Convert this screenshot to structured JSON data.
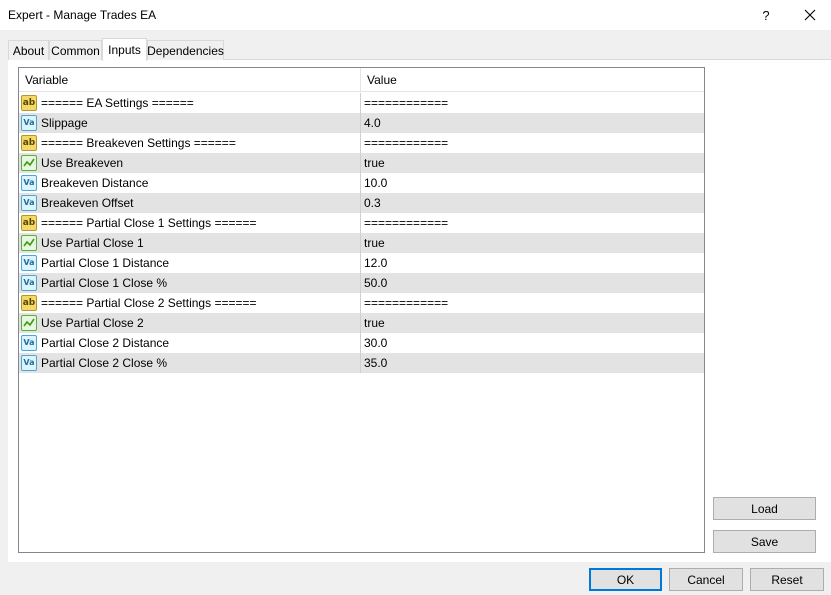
{
  "window": {
    "title": "Expert - Manage Trades EA",
    "help_label": "?",
    "close_icon": "close-icon"
  },
  "tabs": [
    {
      "label": "About"
    },
    {
      "label": "Common"
    },
    {
      "label": "Inputs"
    },
    {
      "label": "Dependencies"
    }
  ],
  "active_tab": "Inputs",
  "grid": {
    "columns": [
      "Variable",
      "Value"
    ],
    "rows": [
      {
        "type": "string",
        "icon": "ab",
        "name": "====== EA Settings ======",
        "value": "============"
      },
      {
        "type": "double",
        "icon": "Va",
        "name": "Slippage",
        "value": "4.0"
      },
      {
        "type": "string",
        "icon": "ab",
        "name": "====== Breakeven Settings ======",
        "value": "============"
      },
      {
        "type": "bool",
        "icon": "bool",
        "name": "Use Breakeven",
        "value": "true"
      },
      {
        "type": "double",
        "icon": "Va",
        "name": "Breakeven Distance",
        "value": "10.0"
      },
      {
        "type": "double",
        "icon": "Va",
        "name": "Breakeven Offset",
        "value": "0.3"
      },
      {
        "type": "string",
        "icon": "ab",
        "name": "====== Partial Close 1 Settings ======",
        "value": "============"
      },
      {
        "type": "bool",
        "icon": "bool",
        "name": "Use Partial Close 1",
        "value": "true"
      },
      {
        "type": "double",
        "icon": "Va",
        "name": "Partial Close 1 Distance",
        "value": "12.0"
      },
      {
        "type": "double",
        "icon": "Va",
        "name": "Partial Close 1 Close %",
        "value": "50.0"
      },
      {
        "type": "string",
        "icon": "ab",
        "name": "====== Partial Close 2 Settings ======",
        "value": "============"
      },
      {
        "type": "bool",
        "icon": "bool",
        "name": "Use Partial Close 2",
        "value": "true"
      },
      {
        "type": "double",
        "icon": "Va",
        "name": "Partial Close 2 Distance",
        "value": "30.0"
      },
      {
        "type": "double",
        "icon": "Va",
        "name": "Partial Close 2 Close %",
        "value": "35.0"
      }
    ]
  },
  "side_buttons": {
    "load": "Load",
    "save": "Save"
  },
  "footer_buttons": {
    "ok": "OK",
    "cancel": "Cancel",
    "reset": "Reset"
  },
  "colors": {
    "accent": "#0078d7",
    "row_alt": "#e3e3e3"
  }
}
